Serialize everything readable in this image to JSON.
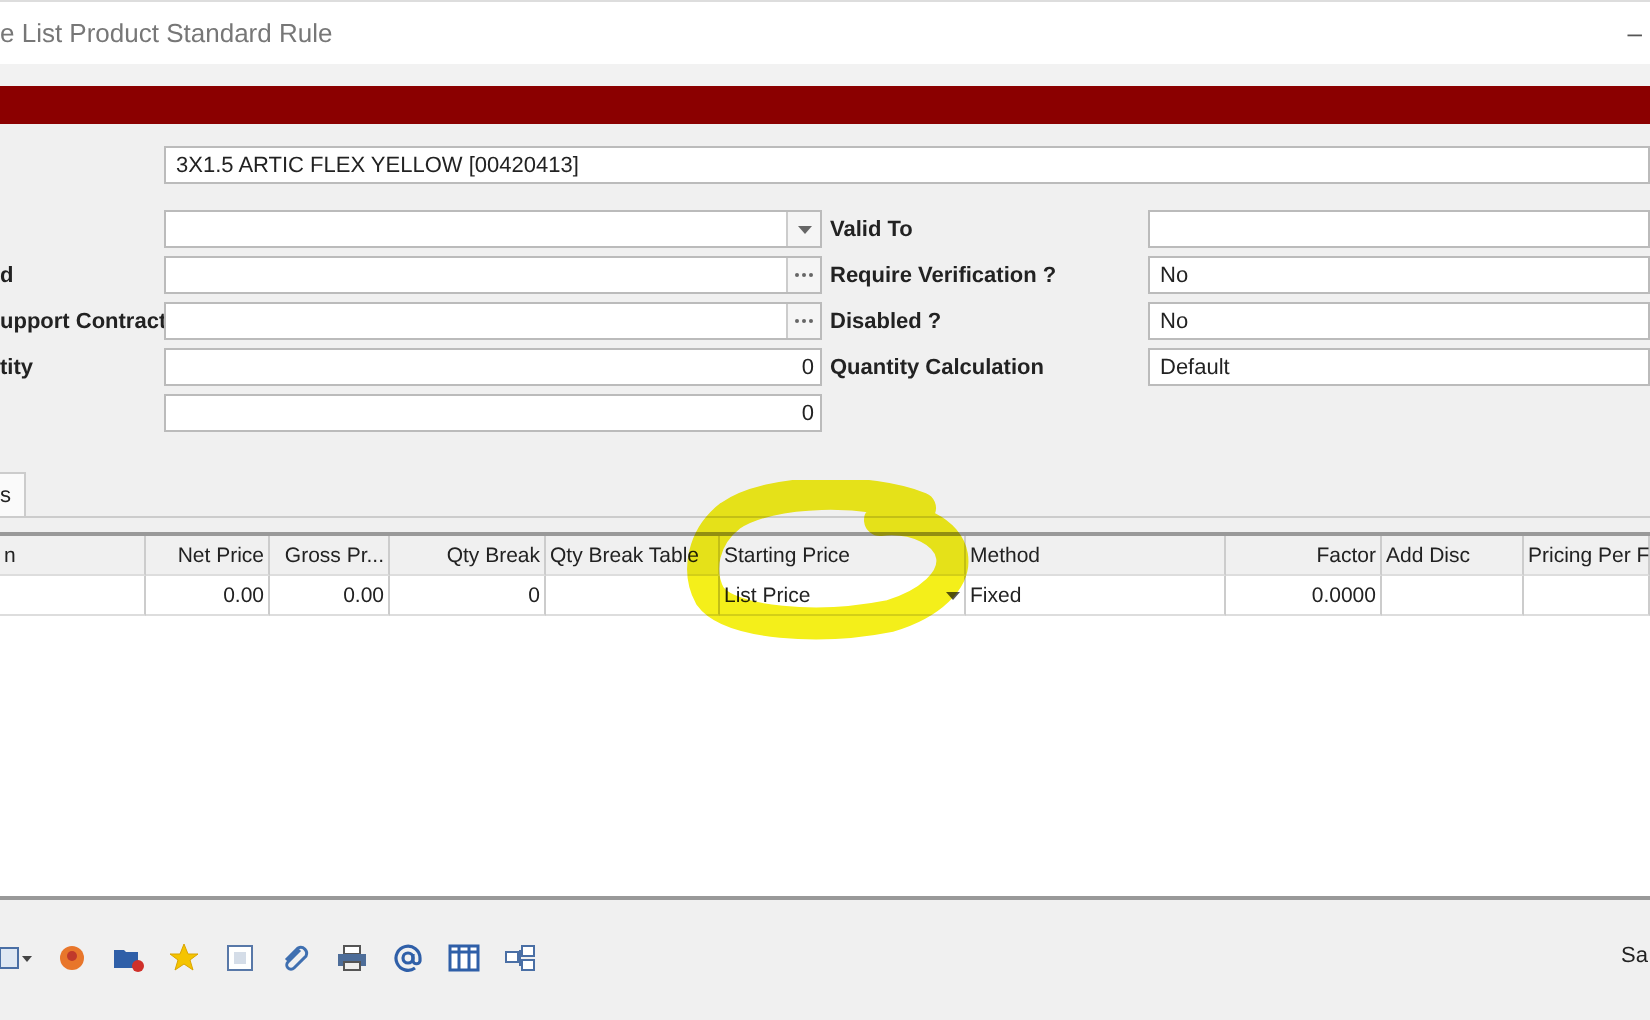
{
  "window": {
    "title": "e List Product Standard Rule",
    "minimize": "–"
  },
  "product": {
    "value": "3X1.5 ARTIC FLEX YELLOW [00420413]"
  },
  "left_fields": [
    {
      "kind": "dropdown"
    },
    {
      "label": "d",
      "kind": "lookup"
    },
    {
      "label": "upport Contract",
      "kind": "lookup"
    },
    {
      "label": "tity",
      "kind": "number",
      "value": "0"
    },
    {
      "kind": "number",
      "value": "0"
    }
  ],
  "right_fields": [
    {
      "label": "Valid To"
    },
    {
      "label": "Require Verification ?",
      "value": "No"
    },
    {
      "label": "Disabled ?",
      "value": "No"
    },
    {
      "label": "Quantity Calculation",
      "value": "Default"
    }
  ],
  "tabs": [
    {
      "label": "s",
      "selected": true
    }
  ],
  "grid": {
    "columns": [
      {
        "title": "n",
        "kind": "text"
      },
      {
        "title": "Net Price",
        "kind": "number"
      },
      {
        "title": "Gross Pr...",
        "kind": "number"
      },
      {
        "title": "Qty Break",
        "kind": "number"
      },
      {
        "title": "Qty Break Table",
        "kind": "text"
      },
      {
        "title": "Starting Price",
        "kind": "dropdown"
      },
      {
        "title": "Method",
        "kind": "text"
      },
      {
        "title": "Factor",
        "kind": "number"
      },
      {
        "title": "Add Disc",
        "kind": "text"
      },
      {
        "title": "Pricing Per F",
        "kind": "text"
      }
    ],
    "rows": [
      {
        "cells": [
          "",
          "0.00",
          "0.00",
          "0",
          "",
          "List Price",
          "Fixed",
          "0.0000",
          "",
          ""
        ]
      }
    ]
  },
  "status": {
    "text": "Sa"
  }
}
